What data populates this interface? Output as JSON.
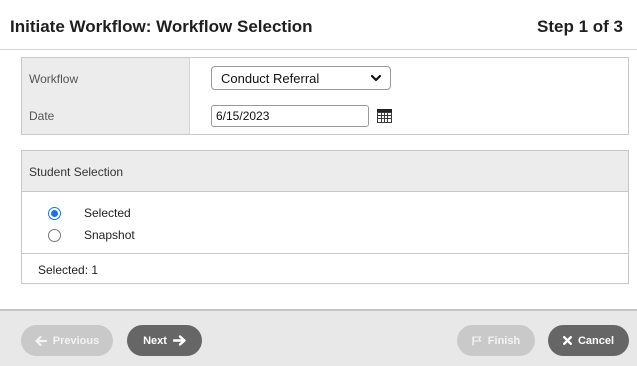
{
  "header": {
    "title": "Initiate Workflow: Workflow Selection",
    "step": "Step 1 of 3"
  },
  "params": {
    "workflow_label": "Workflow",
    "workflow_value": "Conduct Referral",
    "date_label": "Date",
    "date_value": "6/15/2023"
  },
  "student_selection": {
    "heading": "Student Selection",
    "options": [
      {
        "label": "Selected",
        "checked": true
      },
      {
        "label": "Snapshot",
        "checked": false
      }
    ],
    "summary": "Selected: 1"
  },
  "footer": {
    "previous_label": "Previous",
    "next_label": "Next",
    "finish_label": "Finish",
    "cancel_label": "Cancel"
  },
  "colors": {
    "radio_accent": "#1a73e8",
    "button_active": "#666666",
    "button_disabled": "#c9c9c9"
  },
  "icons": [
    "chevron-down-icon",
    "calendar-icon",
    "arrow-left-icon",
    "arrow-right-icon",
    "flag-icon",
    "close-icon"
  ]
}
